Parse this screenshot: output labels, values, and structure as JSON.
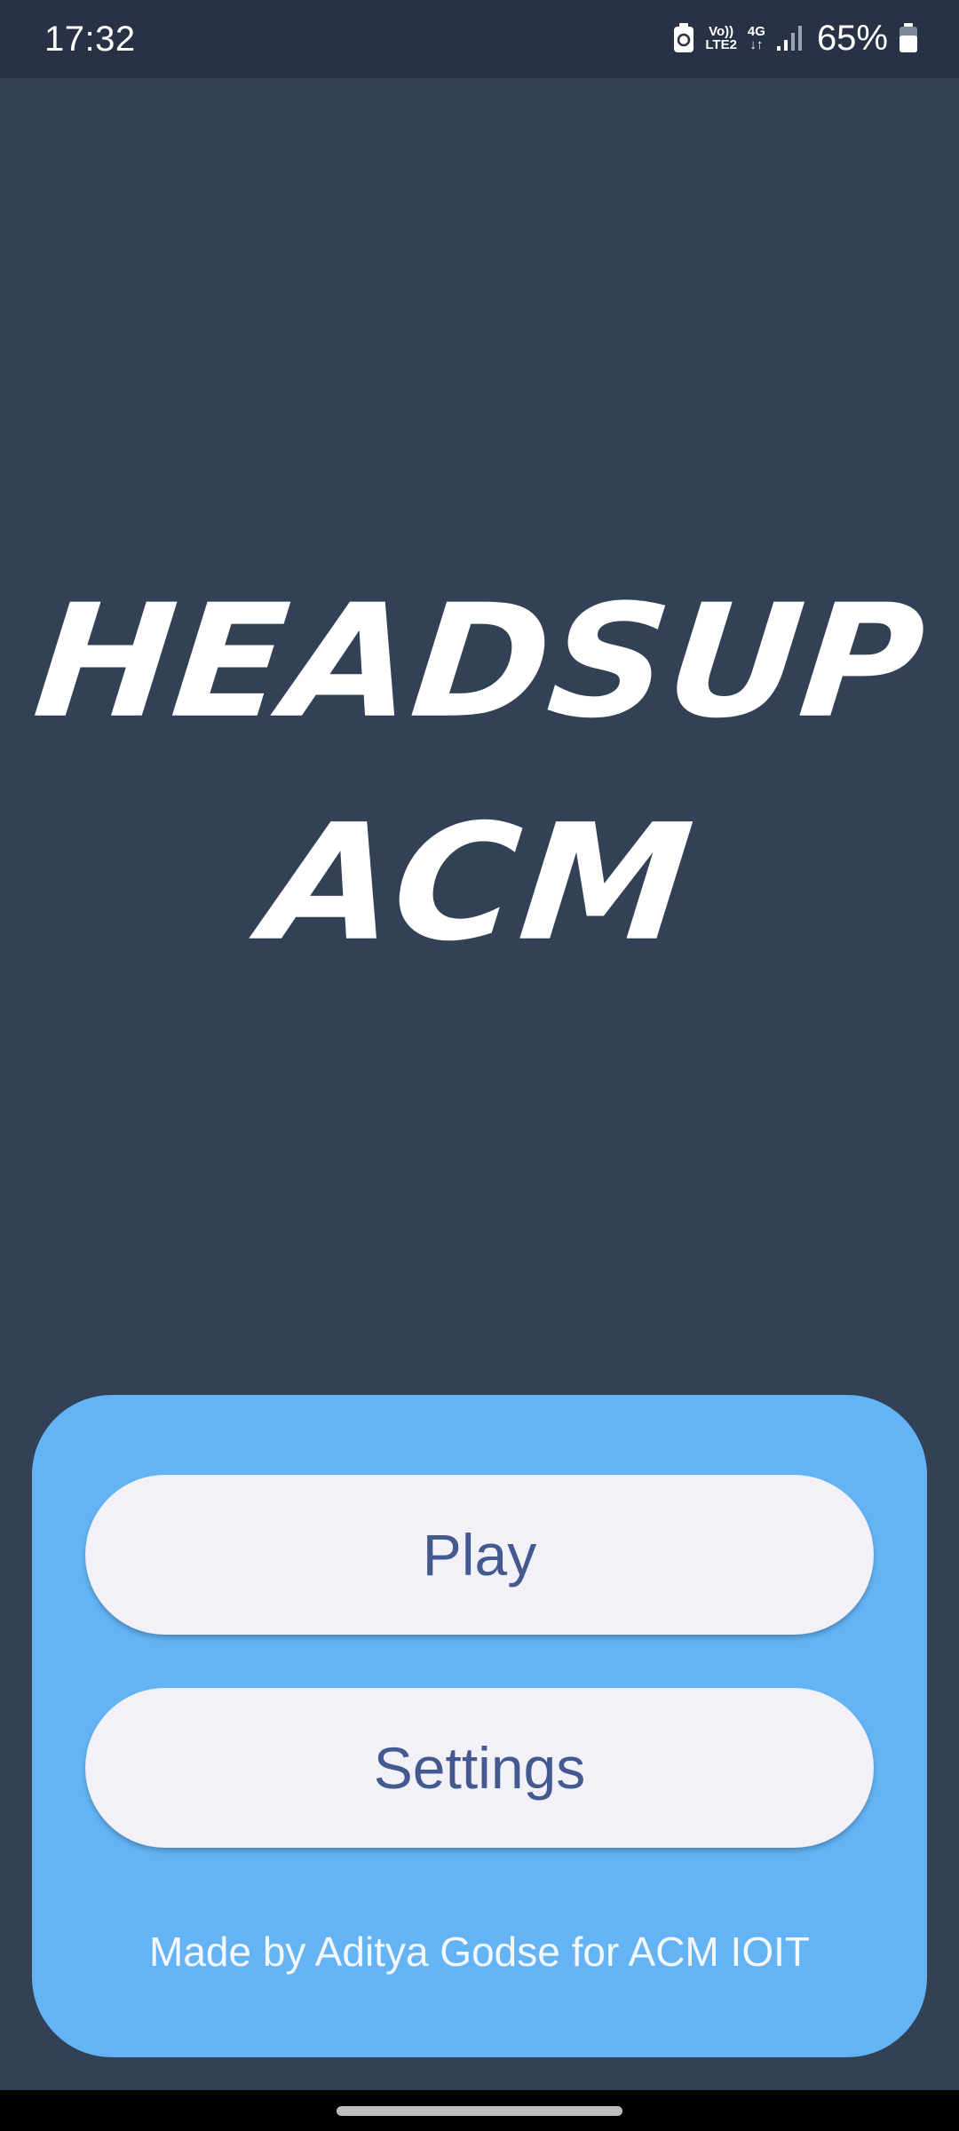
{
  "status_bar": {
    "time": "17:32",
    "network_top": "Vo))",
    "network_bottom": "LTE2",
    "data_type": "4G",
    "battery_percent": "65%",
    "icons": [
      "battery-saver-icon",
      "volte-icon",
      "data-arrows-icon",
      "signal-icon",
      "battery-icon"
    ]
  },
  "app": {
    "title_line1": "Headsup",
    "title_line2": "ACM"
  },
  "menu": {
    "play_label": "Play",
    "settings_label": "Settings",
    "credit": "Made by Aditya Godse for ACM IOIT"
  },
  "colors": {
    "background": "#334157",
    "panel": "#64b4f5",
    "button": "#f2f1f8",
    "button_text": "#43598f"
  }
}
